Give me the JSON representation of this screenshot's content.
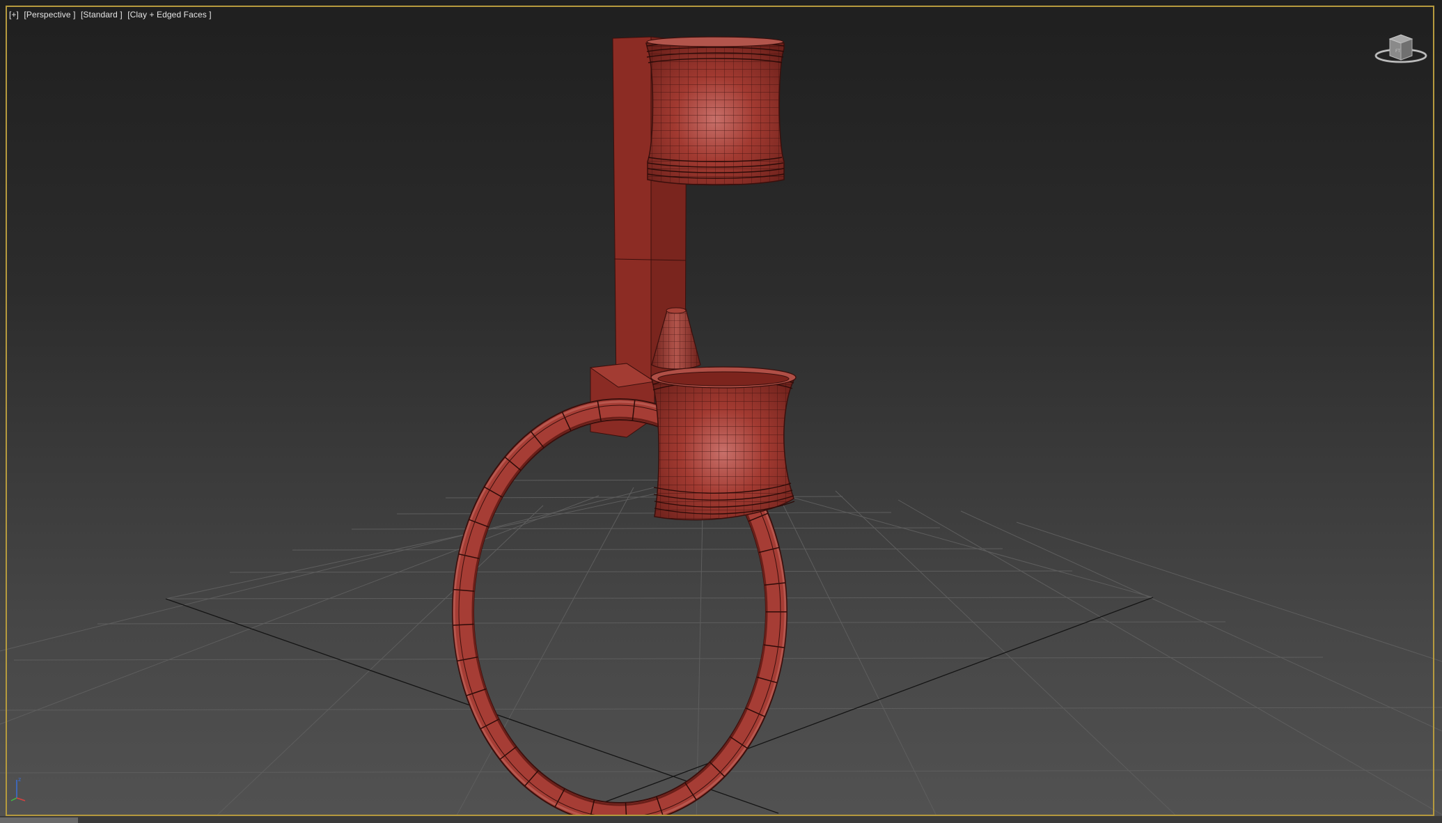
{
  "viewport": {
    "label_parts": [
      "[+]",
      "[Perspective ]",
      "[Standard ]",
      "[Clay + Edged Faces ]"
    ],
    "border_color": "#b69a3e",
    "background_top": "#1f1f1f",
    "background_bottom": "#525252"
  },
  "model": {
    "object_color": "#8f2f27",
    "wire_color": "#3a0f0c"
  },
  "icons": {
    "viewcube": "viewcube-icon",
    "axis": "axis-tripod-icon"
  }
}
